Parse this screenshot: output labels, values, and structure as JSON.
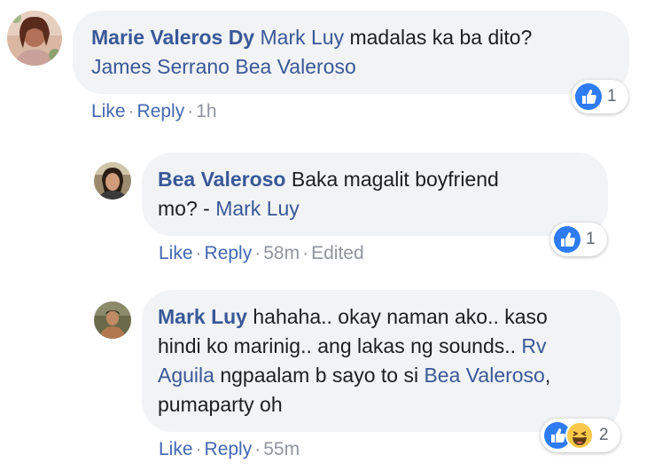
{
  "comments": [
    {
      "author": "Marie Valeros Dy",
      "segments": [
        {
          "text": "Mark Luy",
          "mention": true
        },
        {
          "text": " madalas ka ba dito?",
          "mention": false
        }
      ],
      "line2": [
        {
          "text": "James Serrano Bea Valeroso",
          "mention": true
        }
      ],
      "actions": {
        "like": "Like",
        "reply": "Reply",
        "time": "1h"
      },
      "reaction_count": "1",
      "colors": {
        "avatar": "#c98a72"
      }
    },
    {
      "author": "Bea Valeroso",
      "text1": " Baka magalit boyfriend",
      "text2": "mo? - ",
      "mention2": "Mark Luy",
      "actions": {
        "like": "Like",
        "reply": "Reply",
        "time": "58m",
        "edited": "Edited"
      },
      "reaction_count": "1"
    },
    {
      "author": "Mark Luy",
      "text1": " hahaha.. okay naman ako.. kaso",
      "text2": "hindi ko marinig.. ang lakas ng sounds..",
      "mention2": "Rv",
      "mention3": "Aguila",
      "text3": " ngpaalam b sayo to si ",
      "mention3b": "Bea Valeroso",
      "text3b": ",",
      "text4": "pumaparty oh",
      "actions": {
        "like": "Like",
        "reply": "Reply",
        "time": "55m"
      },
      "reaction_count": "2"
    }
  ],
  "separator": "·",
  "icons": [
    "like-icon",
    "haha-icon"
  ]
}
